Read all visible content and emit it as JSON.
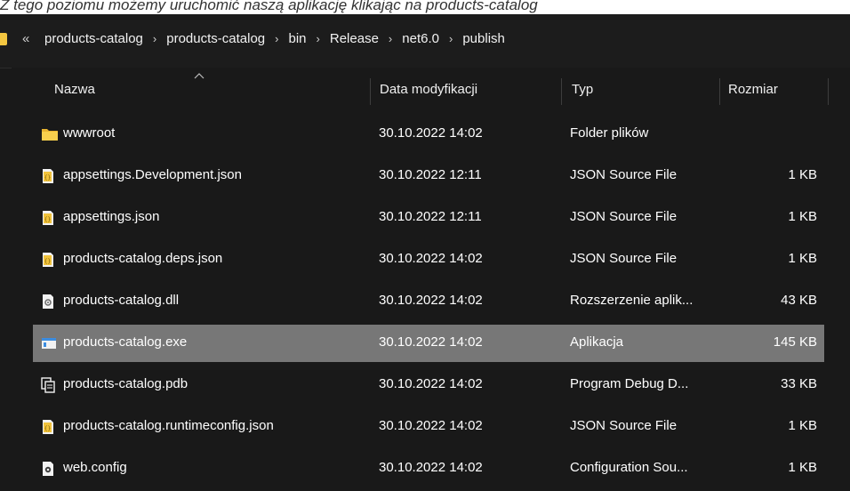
{
  "caption": "Z tego poziomu możemy uruchomić naszą aplikację klikając na products-catalog",
  "breadcrumb": {
    "overflow": "«",
    "separator": "›",
    "items": [
      "products-catalog",
      "products-catalog",
      "bin",
      "Release",
      "net6.0",
      "publish"
    ]
  },
  "columns": {
    "name": "Nazwa",
    "date": "Data modyfikacji",
    "type": "Typ",
    "size": "Rozmiar"
  },
  "files": [
    {
      "name": "wwwroot",
      "date": "30.10.2022 14:02",
      "type": "Folder plików",
      "size": "",
      "icon": "folder-icon"
    },
    {
      "name": "appsettings.Development.json",
      "date": "30.10.2022 12:11",
      "type": "JSON Source File",
      "size": "1 KB",
      "icon": "json-file-icon"
    },
    {
      "name": "appsettings.json",
      "date": "30.10.2022 12:11",
      "type": "JSON Source File",
      "size": "1 KB",
      "icon": "json-file-icon"
    },
    {
      "name": "products-catalog.deps.json",
      "date": "30.10.2022 14:02",
      "type": "JSON Source File",
      "size": "1 KB",
      "icon": "json-file-icon"
    },
    {
      "name": "products-catalog.dll",
      "date": "30.10.2022 14:02",
      "type": "Rozszerzenie aplik...",
      "size": "43 KB",
      "icon": "dll-file-icon"
    },
    {
      "name": "products-catalog.exe",
      "date": "30.10.2022 14:02",
      "type": "Aplikacja",
      "size": "145 KB",
      "icon": "exe-file-icon",
      "selected": true
    },
    {
      "name": "products-catalog.pdb",
      "date": "30.10.2022 14:02",
      "type": "Program Debug D...",
      "size": "33 KB",
      "icon": "pdb-file-icon"
    },
    {
      "name": "products-catalog.runtimeconfig.json",
      "date": "30.10.2022 14:02",
      "type": "JSON Source File",
      "size": "1 KB",
      "icon": "json-file-icon"
    },
    {
      "name": "web.config",
      "date": "30.10.2022 14:02",
      "type": "Configuration Sou...",
      "size": "1 KB",
      "icon": "config-file-icon"
    }
  ],
  "colors": {
    "background": "#191919",
    "selected_row": "#777777",
    "folder": "#f3c640",
    "text": "#ffffff"
  }
}
